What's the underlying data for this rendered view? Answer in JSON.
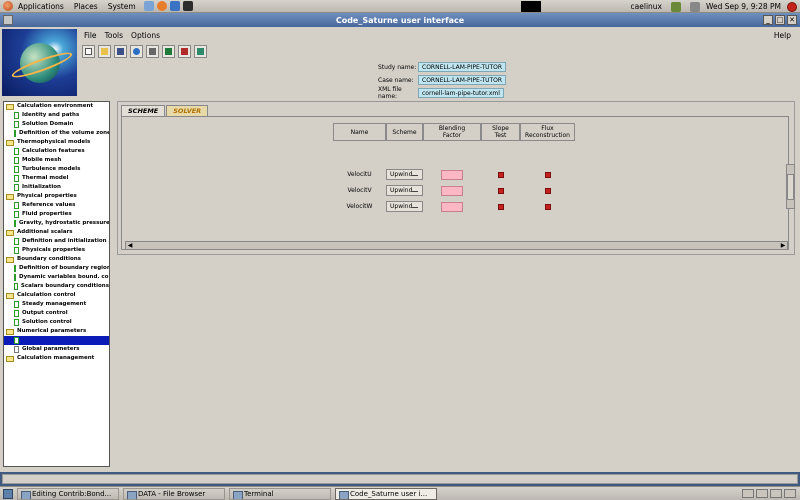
{
  "panel": {
    "menus": [
      "Applications",
      "Places",
      "System"
    ],
    "hostname": "caelinux",
    "clock": "Wed Sep  9,  9:28 PM"
  },
  "window": {
    "title": "Code_Saturne user interface",
    "btn_min": "_",
    "btn_max": "□",
    "btn_close": "✕"
  },
  "menubar": {
    "file": "File",
    "tools": "Tools",
    "options": "Options",
    "help": "Help"
  },
  "study": {
    "study_label": "Study name:",
    "study_value": "CORNELL-LAM-PIPE-TUTOR",
    "case_label": "Case name:",
    "case_value": "CORNELL-LAM-PIPE-TUTOR",
    "xml_label": "XML file name:",
    "xml_value": "cornell-lam-pipe-tutor.xml"
  },
  "tree": [
    {
      "label": "Calculation environment",
      "kind": "folder"
    },
    {
      "label": "Identity and paths",
      "kind": "doc"
    },
    {
      "label": "Solution Domain",
      "kind": "doc"
    },
    {
      "label": "Definition of the volume zones",
      "kind": "doc"
    },
    {
      "label": "Thermophysical models",
      "kind": "folder"
    },
    {
      "label": "Calculation features",
      "kind": "doc"
    },
    {
      "label": "Mobile mesh",
      "kind": "doc"
    },
    {
      "label": "Turbulence models",
      "kind": "doc"
    },
    {
      "label": "Thermal model",
      "kind": "doc"
    },
    {
      "label": "Initialization",
      "kind": "doc"
    },
    {
      "label": "Physical properties",
      "kind": "folder"
    },
    {
      "label": "Reference values",
      "kind": "doc"
    },
    {
      "label": "Fluid properties",
      "kind": "doc"
    },
    {
      "label": "Gravity, hydrostatic pressure",
      "kind": "doc"
    },
    {
      "label": "Additional scalars",
      "kind": "folder"
    },
    {
      "label": "Definition and initialization",
      "kind": "doc"
    },
    {
      "label": "Physicals properties",
      "kind": "doc"
    },
    {
      "label": "Boundary conditions",
      "kind": "folder"
    },
    {
      "label": "Definition of boundary regions",
      "kind": "doc"
    },
    {
      "label": "Dynamic variables bound. cond.",
      "kind": "doc"
    },
    {
      "label": "Scalars boundary conditions",
      "kind": "doc"
    },
    {
      "label": "Calculation control",
      "kind": "folder"
    },
    {
      "label": "Steady management",
      "kind": "doc"
    },
    {
      "label": "Output control",
      "kind": "doc"
    },
    {
      "label": "Solution control",
      "kind": "doc"
    },
    {
      "label": "Numerical parameters",
      "kind": "folder"
    },
    {
      "label": "",
      "kind": "doc-selected"
    },
    {
      "label": "Global parameters",
      "kind": "doc-white"
    },
    {
      "label": "Calculation management",
      "kind": "folder"
    }
  ],
  "tabs": {
    "scheme": "SCHEME",
    "solver": "SOLVER"
  },
  "table": {
    "headers": [
      "Name",
      "Scheme",
      "Blending\nFactor",
      "Slope\nTest",
      "Flux\nReconstruction"
    ],
    "rows": [
      {
        "name": "VelocitU",
        "scheme": "Upwind",
        "slope": true,
        "flux": true
      },
      {
        "name": "VelocitV",
        "scheme": "Upwind",
        "slope": true,
        "flux": true
      },
      {
        "name": "VelocitW",
        "scheme": "Upwind",
        "slope": true,
        "flux": true
      }
    ]
  },
  "taskbar": [
    {
      "label": "Editing Contrib:Bond...",
      "active": false
    },
    {
      "label": "DATA - File Browser",
      "active": false
    },
    {
      "label": "Terminal",
      "active": false
    },
    {
      "label": "Code_Saturne user i...",
      "active": true
    }
  ],
  "colors": {
    "selected": "#0a1bb8",
    "checkbox": "#c81f1f",
    "blending": "#fbb8c4",
    "field": "#bfe6f0"
  }
}
